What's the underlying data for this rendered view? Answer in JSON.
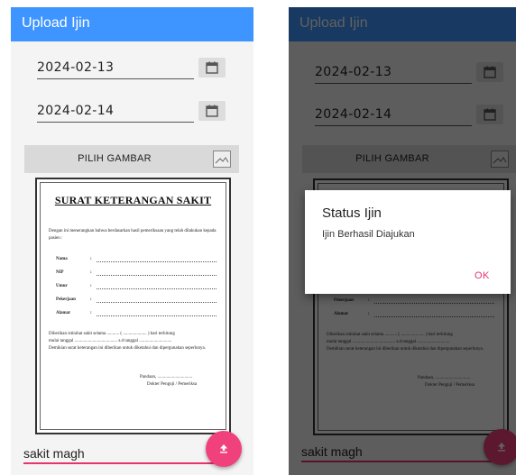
{
  "app": {
    "title": "Upload Ijin"
  },
  "form": {
    "start_date": "2024-02-13",
    "end_date": "2024-02-14",
    "pick_image_label": "PILIH GAMBAR",
    "reason_value": "sakit magh"
  },
  "document": {
    "title": "SURAT KETERANGAN SAKIT",
    "intro": "Dengan ini menerangkan bahwa berdasarkan hasil pemeriksaan yang telah dilakukan kepada pasien :",
    "fields": [
      {
        "label": "Nama"
      },
      {
        "label": "NIP"
      },
      {
        "label": "Umur"
      },
      {
        "label": "Pekerjaan"
      },
      {
        "label": "Alamat"
      }
    ],
    "rest_line": "Diberikan istirahat sakit selama ........... ( ..................... ) hari terhitung",
    "date_line": "mulai tanggal ...................................... s.d tanggal .............................",
    "usage_line": "Demikian surat keterangan ini diberikan untuk diketahui dan dipergunakan seperlunya.",
    "place_line": "Pandaan, ...............................",
    "signer": "Dokter Penguji / Pemeriksa"
  },
  "dialog": {
    "title": "Status Ijin",
    "message": "Ijin Berhasil Diajukan",
    "ok_label": "OK"
  },
  "colors": {
    "appbar": "#3f95ff",
    "accent": "#f0417c",
    "underline": "#e8336b"
  },
  "icons": {
    "date_picker": "calendar-icon",
    "pick_image": "image-icon",
    "upload": "upload-icon"
  }
}
